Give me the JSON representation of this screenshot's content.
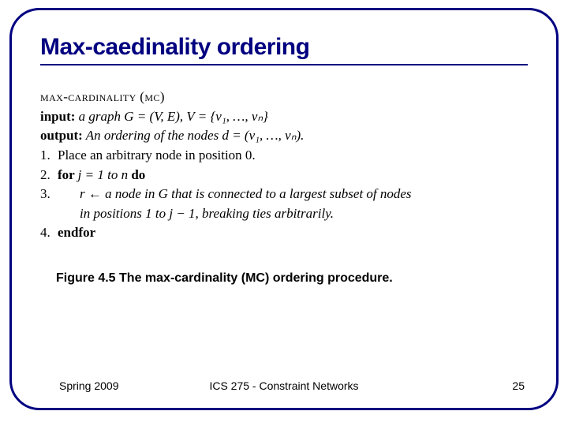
{
  "title": "Max-caedinality ordering",
  "algorithm": {
    "name_sc": "max-cardinality (mc)",
    "input_label": "input:",
    "input_text": " a graph G = (V, E), V = {v₁, …, vₙ}",
    "output_label": "output:",
    "output_text": " An ordering of the nodes d = (v₁, …, vₙ).",
    "lines": {
      "l1_num": "1.",
      "l1": "Place an arbitrary node in position 0.",
      "l2_num": "2.",
      "l2_for": "for ",
      "l2_cond": "j = 1 to n ",
      "l2_do": "do",
      "l3_num": "3.",
      "l3": "r ← a node in G that is connected to a largest subset of nodes",
      "l3b": "in positions 1 to j − 1, breaking ties arbitrarily.",
      "l4_num": "4.",
      "l4": "endfor"
    }
  },
  "caption": "Figure 4.5  The max-cardinality (MC) ordering procedure.",
  "footer": {
    "left": "Spring 2009",
    "center": "ICS 275 - Constraint Networks",
    "right": "25"
  }
}
